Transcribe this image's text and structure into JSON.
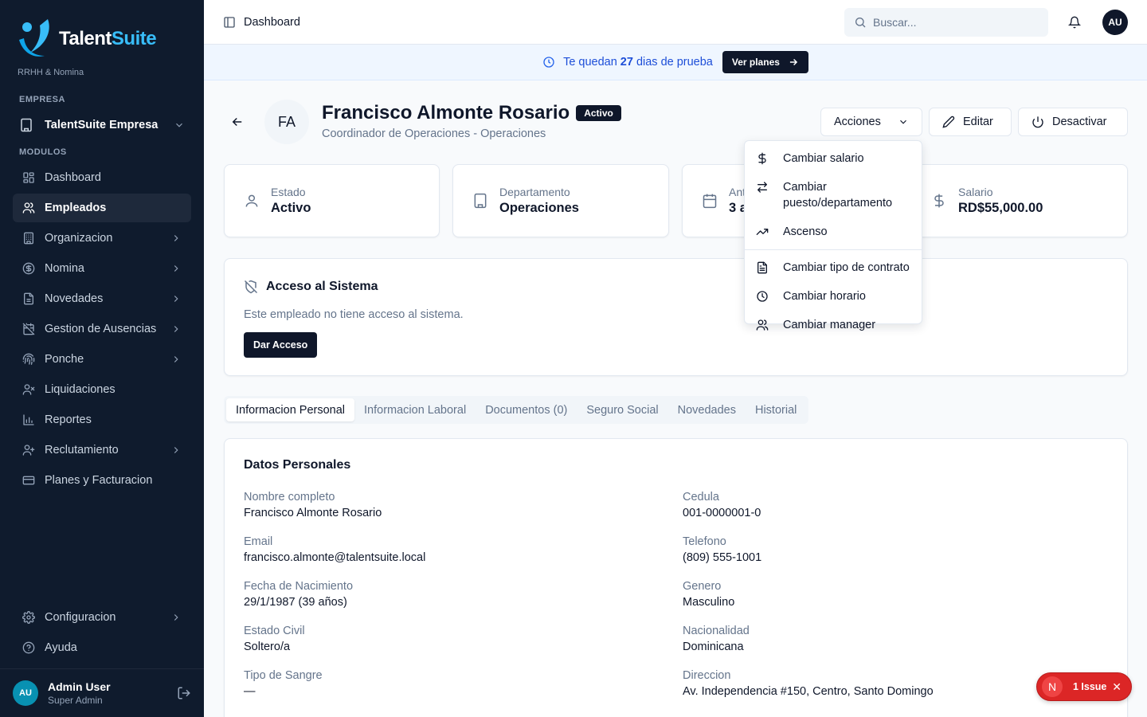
{
  "sidebar": {
    "brand_talent": "Talent",
    "brand_suite": "Suite",
    "brand_sub": "RRHH & Nomina",
    "company_label": "EMPRESA",
    "company_name": "TalentSuite Empresa",
    "modules_label": "MODULOS",
    "items": [
      {
        "label": "Dashboard",
        "icon": "dashboard-icon",
        "chevron": false,
        "active": false
      },
      {
        "label": "Empleados",
        "icon": "users-icon",
        "chevron": false,
        "active": true
      },
      {
        "label": "Organizacion",
        "icon": "building-icon",
        "chevron": true,
        "active": false
      },
      {
        "label": "Nomina",
        "icon": "dollar-circle-icon",
        "chevron": true,
        "active": false
      },
      {
        "label": "Novedades",
        "icon": "file-icon",
        "chevron": true,
        "active": false
      },
      {
        "label": "Gestion de Ausencias",
        "icon": "calendar-off-icon",
        "chevron": true,
        "active": false
      },
      {
        "label": "Ponche",
        "icon": "fingerprint-icon",
        "chevron": true,
        "active": false
      },
      {
        "label": "Liquidaciones",
        "icon": "user-x-icon",
        "chevron": false,
        "active": false
      },
      {
        "label": "Reportes",
        "icon": "bar-chart-icon",
        "chevron": false,
        "active": false
      },
      {
        "label": "Reclutamiento",
        "icon": "user-plus-icon",
        "chevron": true,
        "active": false
      },
      {
        "label": "Planes y Facturacion",
        "icon": "credit-card-icon",
        "chevron": false,
        "active": false
      }
    ],
    "bottom_items": [
      {
        "label": "Configuracion",
        "icon": "gear-icon"
      },
      {
        "label": "Ayuda",
        "icon": "help-icon"
      }
    ],
    "user": {
      "initials": "AU",
      "name": "Admin User",
      "role": "Super Admin"
    }
  },
  "header": {
    "breadcrumb": "Dashboard",
    "search_placeholder": "Buscar...",
    "avatar_initials": "AU"
  },
  "trial": {
    "prefix": "Te quedan",
    "days": "27",
    "suffix": "dias de prueba",
    "button": "Ver planes"
  },
  "employee": {
    "initials": "FA",
    "name": "Francisco Almonte Rosario",
    "status_badge": "Activo",
    "subtitle": "Coordinador de Operaciones - Operaciones"
  },
  "actions": {
    "acciones": "Acciones",
    "editar": "Editar",
    "desactivar": "Desactivar"
  },
  "stats": [
    {
      "label": "Estado",
      "value": "Activo",
      "icon": "user-icon"
    },
    {
      "label": "Departamento",
      "value": "Operaciones",
      "icon": "building-icon"
    },
    {
      "label": "Ant",
      "value": "3 a",
      "icon": "calendar-icon"
    },
    {
      "label": "Salario",
      "value": "RD$55,000.00",
      "icon": "dollar-icon"
    }
  ],
  "access": {
    "title": "Acceso al Sistema",
    "text": "Este empleado no tiene acceso al sistema.",
    "button": "Dar Acceso"
  },
  "tabs": [
    {
      "label": "Informacion Personal",
      "active": true
    },
    {
      "label": "Informacion Laboral",
      "active": false
    },
    {
      "label": "Documentos (0)",
      "active": false
    },
    {
      "label": "Seguro Social",
      "active": false
    },
    {
      "label": "Novedades",
      "active": false
    },
    {
      "label": "Historial",
      "active": false
    }
  ],
  "personal": {
    "title": "Datos Personales",
    "fields": [
      {
        "label": "Nombre completo",
        "value": "Francisco Almonte Rosario"
      },
      {
        "label": "Cedula",
        "value": "001-0000001-0"
      },
      {
        "label": "Email",
        "value": "francisco.almonte@talentsuite.local"
      },
      {
        "label": "Telefono",
        "value": "(809) 555-1001"
      },
      {
        "label": "Fecha de Nacimiento",
        "value": "29/1/1987 (39 años)"
      },
      {
        "label": "Genero",
        "value": "Masculino"
      },
      {
        "label": "Estado Civil",
        "value": "Soltero/a"
      },
      {
        "label": "Nacionalidad",
        "value": "Dominicana"
      },
      {
        "label": "Tipo de Sangre",
        "value": "—"
      },
      {
        "label": "Direccion",
        "value": "Av. Independencia #150, Centro, Santo Domingo"
      }
    ]
  },
  "menu": {
    "items": [
      {
        "label": "Cambiar salario",
        "icon": "dollar-icon"
      },
      {
        "label": "Cambiar puesto/departamento",
        "icon": "swap-icon"
      },
      {
        "label": "Ascenso",
        "icon": "trending-up-icon"
      },
      {
        "label": "Cambiar tipo de contrato",
        "icon": "file-text-icon"
      },
      {
        "label": "Cambiar horario",
        "icon": "clock-icon"
      },
      {
        "label": "Cambiar manager",
        "icon": "users-icon"
      }
    ]
  },
  "issue": {
    "letter": "N",
    "label": "1 Issue"
  }
}
